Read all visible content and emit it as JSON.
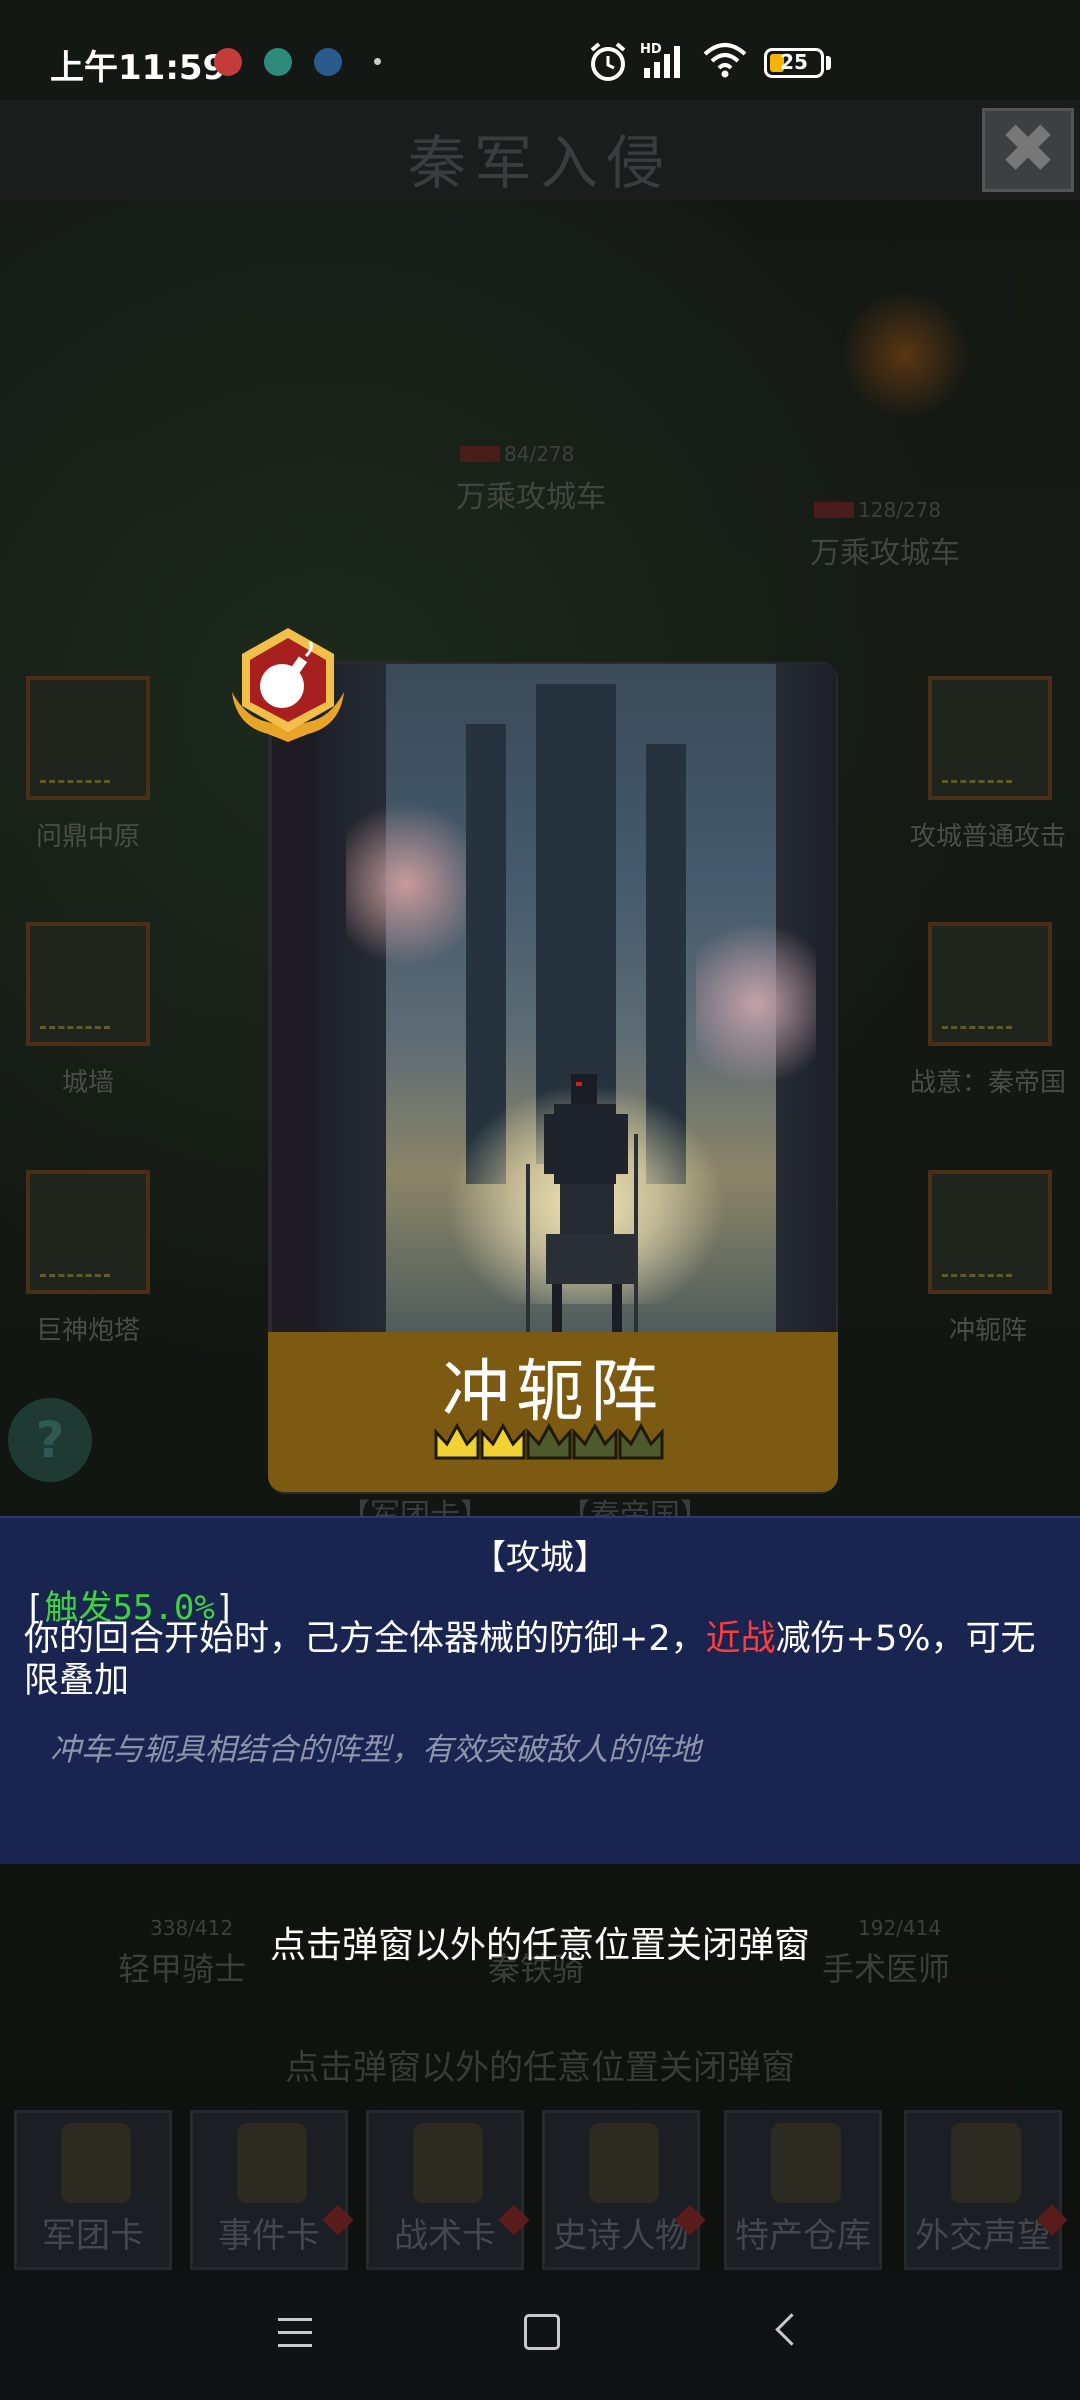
{
  "status_bar": {
    "time": "上午11:59",
    "signal_label": "HD",
    "battery": "25",
    "colors": {
      "battery_fill": "#f4b400"
    }
  },
  "game": {
    "title": "秦军入侵",
    "close_label": "✖",
    "enemies": [
      {
        "name": "万乘攻城车",
        "hp": "84/278"
      },
      {
        "name": "万乘攻城车",
        "hp": "128/278"
      }
    ],
    "left_slots": [
      {
        "label": "问鼎中原"
      },
      {
        "label": "城墙"
      },
      {
        "label": "巨神炮塔"
      }
    ],
    "right_slots": [
      {
        "label": "攻城普通攻击"
      },
      {
        "label": "战意：秦帝国"
      },
      {
        "label": "冲轭阵"
      }
    ],
    "help_label": "?",
    "mid_tabs": [
      "【军团卡】",
      "【秦帝国】"
    ],
    "units": [
      {
        "name": "轻甲骑士",
        "hp": "338/412"
      },
      {
        "name": "秦铁骑",
        "hp": ""
      },
      {
        "name": "手术医师",
        "hp": "192/414"
      }
    ],
    "bg_hint": "点击弹窗以外的任意位置关闭弹窗",
    "tabs": [
      {
        "label": "军团卡"
      },
      {
        "label": "事件卡"
      },
      {
        "label": "战术卡"
      },
      {
        "label": "史诗人物"
      },
      {
        "label": "特产仓库"
      },
      {
        "label": "外交声望"
      }
    ]
  },
  "card": {
    "name": "冲轭阵",
    "stars_filled": 2,
    "stars_total": 5,
    "badge_icon": "bomb-icon",
    "colors": {
      "band": "#7d5a12",
      "crown_on": "#f0d234",
      "crown_off": "#4e5a2c"
    }
  },
  "description": {
    "tag": "【攻城】",
    "trigger_open": "[",
    "trigger": "触发55.0%",
    "trigger_close": "]",
    "main_before": "你的回合开始时，己方全体器械的防御+2，",
    "main_red": "近战",
    "main_after": "减伤+5%，可无限叠加",
    "flavor": "冲车与轭具相结合的阵型，有效突破敌人的阵地",
    "colors": {
      "trigger": "#3fd13f",
      "keyword": "#ff3b3b"
    }
  },
  "close_hint": "点击弹窗以外的任意位置关闭弹窗"
}
